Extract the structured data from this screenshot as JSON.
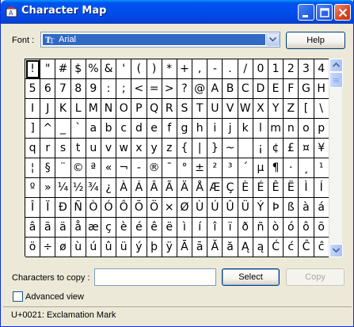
{
  "window": {
    "title": "Character Map"
  },
  "font_row": {
    "label": "Font :",
    "selected_font": "Arial",
    "help_label": "Help"
  },
  "grid": {
    "cells": [
      "!",
      "\"",
      "#",
      "$",
      "%",
      "&",
      "'",
      "(",
      ")",
      "*",
      "+",
      ",",
      "-",
      ".",
      "/",
      "0",
      "1",
      "2",
      "3",
      "4",
      "5",
      "6",
      "7",
      "8",
      "9",
      ":",
      ";",
      "<",
      "=",
      ">",
      "?",
      "@",
      "A",
      "B",
      "C",
      "D",
      "E",
      "F",
      "G",
      "H",
      "I",
      "J",
      "K",
      "L",
      "M",
      "N",
      "O",
      "P",
      "Q",
      "R",
      "S",
      "T",
      "U",
      "V",
      "W",
      "X",
      "Y",
      "Z",
      "[",
      "\\",
      "]",
      "^",
      "_",
      "`",
      "a",
      "b",
      "c",
      "d",
      "e",
      "f",
      "g",
      "h",
      "i",
      "j",
      "k",
      "l",
      "m",
      "n",
      "o",
      "p",
      "q",
      "r",
      "s",
      "t",
      "u",
      "v",
      "w",
      "x",
      "y",
      "z",
      "{",
      "|",
      "}",
      "~",
      "",
      "¡",
      "¢",
      "£",
      "¤",
      "¥",
      "¦",
      "§",
      "¨",
      "©",
      "ª",
      "«",
      "¬",
      "-",
      "®",
      "¯",
      "°",
      "±",
      "²",
      "³",
      "´",
      "µ",
      "¶",
      "·",
      "¸",
      "¹",
      "º",
      "»",
      "¼",
      "½",
      "¾",
      "¿",
      "À",
      "Á",
      "Â",
      "Ã",
      "Ä",
      "Å",
      "Æ",
      "Ç",
      "È",
      "É",
      "Ê",
      "Ë",
      "Ì",
      "Í",
      "Î",
      "Ï",
      "Ð",
      "Ñ",
      "Ò",
      "Ó",
      "Ô",
      "Õ",
      "Ö",
      "×",
      "Ø",
      "Ù",
      "Ú",
      "Û",
      "Ü",
      "Ý",
      "Þ",
      "ß",
      "à",
      "á",
      "â",
      "ã",
      "ä",
      "å",
      "æ",
      "ç",
      "è",
      "é",
      "ê",
      "ë",
      "ì",
      "í",
      "î",
      "ï",
      "ð",
      "ñ",
      "ò",
      "ó",
      "ô",
      "õ",
      "ö",
      "÷",
      "ø",
      "ù",
      "ú",
      "û",
      "ü",
      "ý",
      "þ",
      "ÿ",
      "Ā",
      "ā",
      "Ă",
      "ă",
      "Ą",
      "ą",
      "Ć",
      "ć",
      "Ĉ",
      "ĉ"
    ],
    "selected_index": 0
  },
  "copy_row": {
    "label": "Characters to copy :",
    "value": "",
    "select_label": "Select",
    "copy_label": "Copy"
  },
  "advanced": {
    "label": "Advanced view",
    "checked": false
  },
  "status": {
    "text": "U+0021: Exclamation Mark"
  },
  "icons": {
    "app": "character-map-icon",
    "font_type": "truetype-icon",
    "dropdown": "chevron-down-icon",
    "scroll_up": "scroll-up-arrow-icon",
    "scroll_down": "scroll-down-arrow-icon"
  },
  "colors": {
    "titlebar": "#0053ee",
    "selection": "#316ac5",
    "window_bg": "#ece9d8"
  }
}
